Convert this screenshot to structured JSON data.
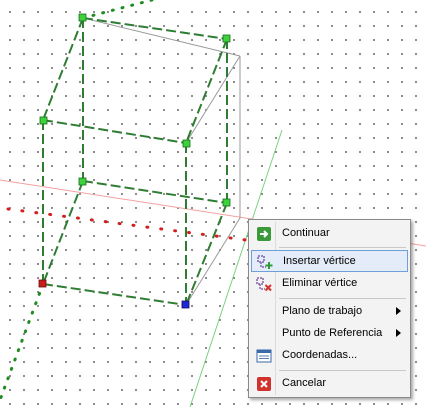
{
  "menu": {
    "continuar": "Continuar",
    "insertar_vertice": "Insertar vértice",
    "eliminar_vertice": "Eliminar vértice",
    "plano_de_trabajo": "Plano de trabajo",
    "punto_de_referencia": "Punto de Referencia",
    "coordenadas": "Coordenadas...",
    "cancelar": "Cancelar"
  },
  "colors": {
    "edge_green": "#2e7d32",
    "vertex_green": "#3cd23c",
    "vertex_red": "#c81e1e",
    "vertex_blue": "#1e28d2",
    "axis_red": "#d21e1e",
    "axis_green": "#1e8c1e",
    "menu_highlight": "#e3ecf8"
  },
  "icons": {
    "continuar": "continue-arrow-icon",
    "insertar_vertice": "insert-vertex-icon",
    "eliminar_vertice": "delete-vertex-icon",
    "coordenadas": "coordinates-window-icon",
    "cancelar": "cancel-x-icon"
  }
}
